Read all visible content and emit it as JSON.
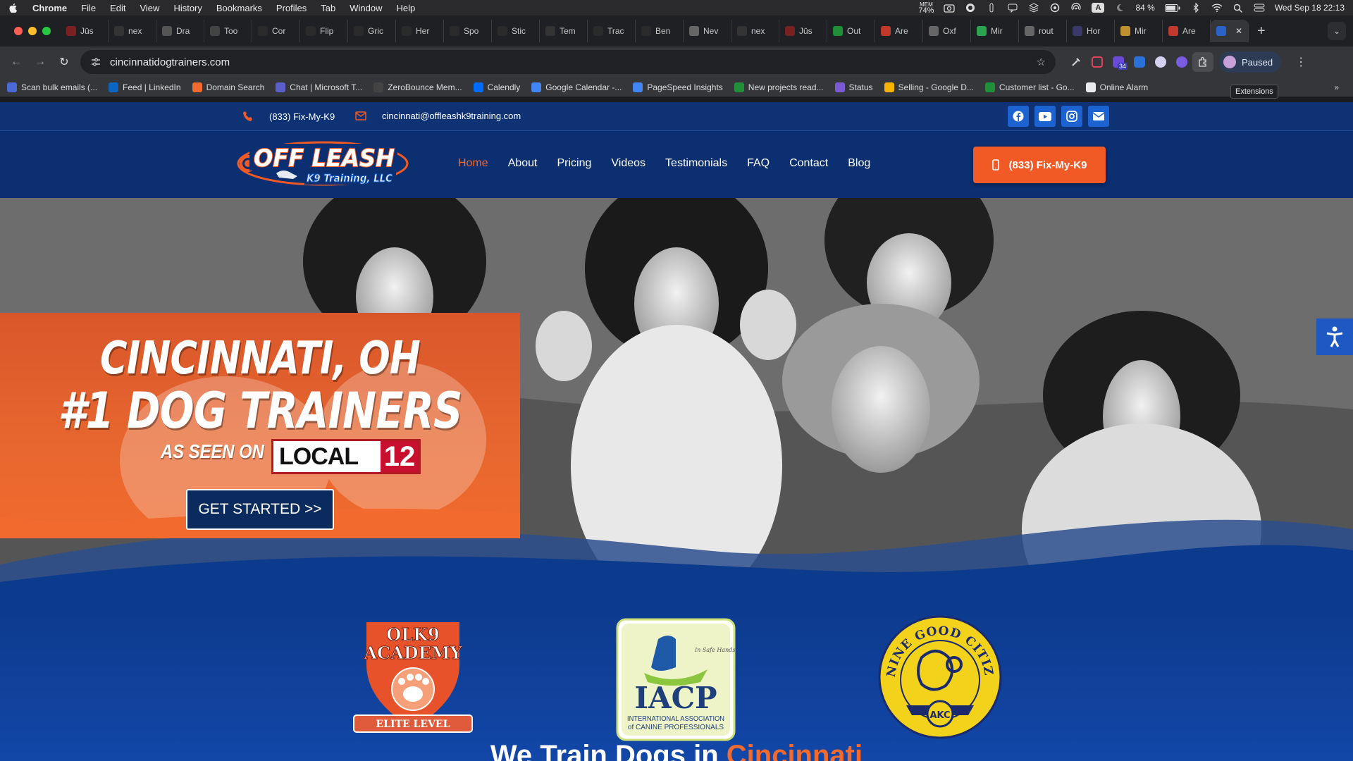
{
  "menubar": {
    "app": "Chrome",
    "items": [
      "File",
      "Edit",
      "View",
      "History",
      "Bookmarks",
      "Profiles",
      "Tab",
      "Window",
      "Help"
    ],
    "mem_label": "MEM",
    "mem_value": "74%",
    "battery": "84 %",
    "datetime": "Wed Sep 18  22:13"
  },
  "tabs": [
    {
      "label": "Jūs",
      "color": "#7a2020"
    },
    {
      "label": "nex",
      "color": "#333"
    },
    {
      "label": "Dra",
      "color": "#555"
    },
    {
      "label": "Too",
      "color": "#444"
    },
    {
      "label": "Cor",
      "color": "#2a2a2a"
    },
    {
      "label": "Flip",
      "color": "#2a2a2a"
    },
    {
      "label": "Gric",
      "color": "#2a2a2a"
    },
    {
      "label": "Her",
      "color": "#2a2a2a"
    },
    {
      "label": "Spo",
      "color": "#2a2a2a"
    },
    {
      "label": "Stic",
      "color": "#2a2a2a"
    },
    {
      "label": "Tem",
      "color": "#333"
    },
    {
      "label": "Trac",
      "color": "#2a2a2a"
    },
    {
      "label": "Ben",
      "color": "#2a2a2a"
    },
    {
      "label": "Nev",
      "color": "#666"
    },
    {
      "label": "nex",
      "color": "#333"
    },
    {
      "label": "Jūs",
      "color": "#7a2020"
    },
    {
      "label": "Out",
      "color": "#1f8f3a"
    },
    {
      "label": "Are",
      "color": "#c0392b"
    },
    {
      "label": "Oxf",
      "color": "#666"
    },
    {
      "label": "Mir",
      "color": "#2aa44f"
    },
    {
      "label": "rout",
      "color": "#666"
    },
    {
      "label": "Hor",
      "color": "#3a3a6a"
    },
    {
      "label": "Mir",
      "color": "#c09030"
    },
    {
      "label": "Are",
      "color": "#c0392b"
    }
  ],
  "url": "cincinnatidogtrainers.com",
  "profile_status": "Paused",
  "extensions_tooltip": "Extensions",
  "extension_badge": "34",
  "bookmarks": [
    {
      "label": "Scan bulk emails (...",
      "color": "#4a6ad8"
    },
    {
      "label": "Feed | LinkedIn",
      "color": "#0a66c2"
    },
    {
      "label": "Domain Search",
      "color": "#f26a2d"
    },
    {
      "label": "Chat | Microsoft T...",
      "color": "#5b5fc7"
    },
    {
      "label": "ZeroBounce Mem...",
      "color": "#444"
    },
    {
      "label": "Calendly",
      "color": "#006bff"
    },
    {
      "label": "Google Calendar -...",
      "color": "#4285f4"
    },
    {
      "label": "PageSpeed Insights",
      "color": "#4285f4"
    },
    {
      "label": "New projects read...",
      "color": "#1f8f3a"
    },
    {
      "label": "Status",
      "color": "#7b5cd6"
    },
    {
      "label": "Selling - Google D...",
      "color": "#f4b400"
    },
    {
      "label": "Customer list - Go...",
      "color": "#1f8f3a"
    },
    {
      "label": "Online Alarm",
      "color": "#e8eaed"
    }
  ],
  "site": {
    "phone": "(833) Fix-My-K9",
    "email": "cincinnati@offleashk9training.com",
    "logo_text_1": "OFF LEASH",
    "logo_text_2": "K9 Training, LLC",
    "nav": [
      "Home",
      "About",
      "Pricing",
      "Videos",
      "Testimonials",
      "FAQ",
      "Contact",
      "Blog"
    ],
    "cta_phone": "(833) Fix-My-K9",
    "hero_line1": "CINCINNATI, OH",
    "hero_line2": "#1 DOG TRAINERS",
    "as_seen_on": "AS SEEN ON",
    "local_text": "LOCAL",
    "local_num": "12",
    "get_started": "GET STARTED >>",
    "badge1_line1": "OLK9",
    "badge1_line2": "ACADEMY",
    "badge1_ribbon": "ELITE LEVEL",
    "badge2_title": "IACP",
    "badge2_sub1": "INTERNATIONAL ASSOCIATION",
    "badge2_sub2": "of CANINE PROFESSIONALS",
    "badge2_top": "In Safe Hands",
    "badge3_text": "CANINE GOOD CITIZEN",
    "badge3_akc": "AKC",
    "tagline_white": "We Train Dogs in",
    "tagline_orange": "Cincinnati"
  },
  "colors": {
    "accent": "#f15a24",
    "navy": "#0c2f72"
  }
}
